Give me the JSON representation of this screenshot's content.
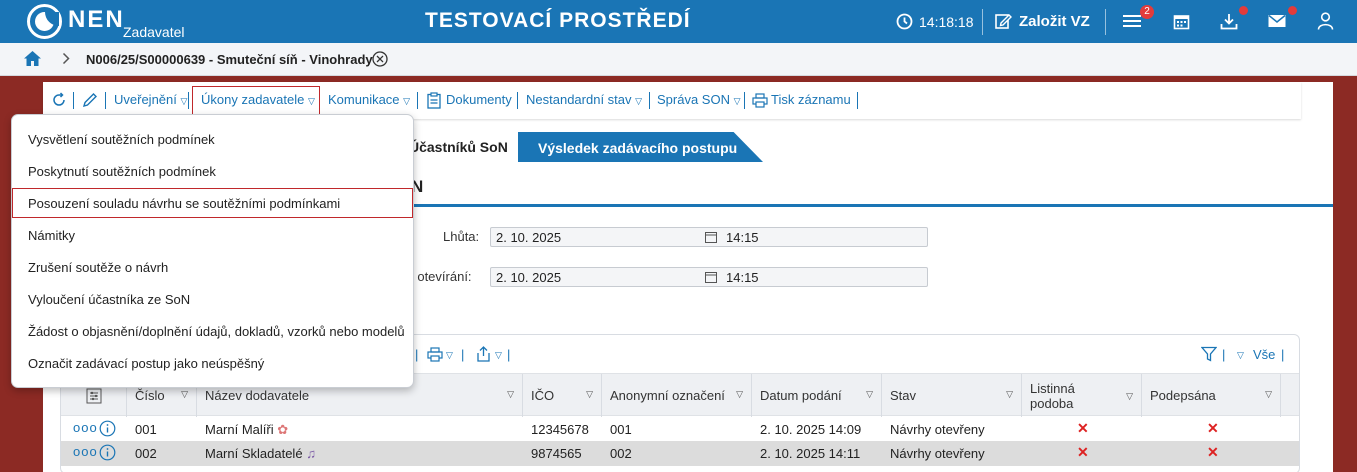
{
  "header": {
    "brand": "NEN",
    "brand_sub": "Zadavatel",
    "environment_title": "TESTOVACÍ PROSTŘEDÍ",
    "clock": "14:18:18",
    "create_button_label": "Založit VZ",
    "menu_badge_count": "2",
    "icons": [
      "clock-icon",
      "edit-icon",
      "hamburger-icon",
      "calendar-icon",
      "download-icon",
      "mail-icon",
      "user-icon"
    ],
    "accent_color": "#1a75b5",
    "alert_color": "#e23b3b"
  },
  "breadcrumb": {
    "current": "N006/25/S00000639 - Smuteční síň - Vinohrady"
  },
  "toolbar": {
    "publish": "Uveřejnění",
    "actions": "Úkony zadavatele",
    "communication": "Komunikace",
    "documents": "Dokumenty",
    "nonstandard": "Nestandardní stav",
    "son_management": "Správa SON",
    "print_record": "Tisk záznamu"
  },
  "tabs": {
    "participants": "Účastníků SoN",
    "result": "Výsledek zadávacího postupu"
  },
  "section": {
    "title": "N",
    "deadline_label": "Lhůta:",
    "deadline_date": "2. 10. 2025",
    "deadline_time": "14:15",
    "opening_label": "as otevírání:",
    "opening_date": "2. 10. 2025",
    "opening_time": "14:15"
  },
  "grid": {
    "filter_all": "Vše",
    "columns": [
      "Číslo",
      "Název dodavatele",
      "IČO",
      "Anonymní označení",
      "Datum podání",
      "Stav",
      "Listinná podoba",
      "Podepsána"
    ],
    "rows": [
      {
        "cislo": "001",
        "nazev": "Marní Malíři",
        "ico": "12345678",
        "anon": "001",
        "datum": "2. 10. 2025 14:09",
        "stav": "Návrhy otevřeny",
        "listinna": "✕",
        "podepsana": "✕"
      },
      {
        "cislo": "002",
        "nazev": "Marní Skladatelé",
        "ico": "9874565",
        "anon": "002",
        "datum": "2. 10. 2025 14:11",
        "stav": "Návrhy otevřeny",
        "listinna": "✕",
        "podepsana": "✕"
      }
    ]
  },
  "menu": {
    "items": [
      "Vysvětlení soutěžních podmínek",
      "Poskytnutí soutěžních podmínek",
      "Posouzení souladu návrhu se soutěžními podmínkami",
      "Námitky",
      "Zrušení soutěže o návrh",
      "Vyloučení účastníka ze SoN",
      "Žádost o objasnění/doplnění údajů, dokladů, vzorků nebo modelů",
      "Označit zadávací postup jako neúspěšný"
    ]
  }
}
